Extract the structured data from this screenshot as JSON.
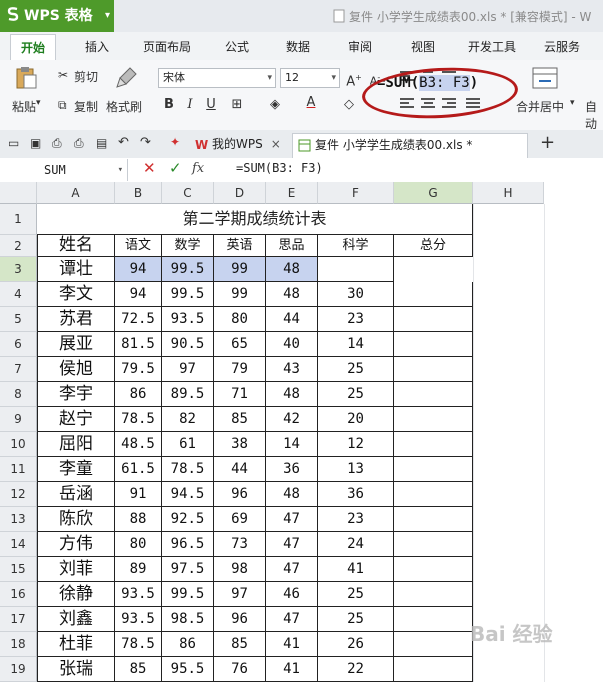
{
  "app": {
    "name": "WPS 表格",
    "doc_title": "复件 小学学生成绩表00.xls * [兼容模式] - W"
  },
  "menu": {
    "tabs": [
      "开始",
      "插入",
      "页面布局",
      "公式",
      "数据",
      "审阅",
      "视图",
      "开发工具",
      "云服务"
    ]
  },
  "toolbar": {
    "cut": "剪切",
    "copy": "复制",
    "paste": "粘贴",
    "format_painter": "格式刷",
    "font_name": "宋体",
    "font_size": "12",
    "merge_center": "合并居中",
    "auto_wrap": "自动"
  },
  "doc_tabs": {
    "tab1": "我的WPS",
    "tab2": "复件  小学学生成绩表00.xls *"
  },
  "formula_bar": {
    "name_box": "SUM",
    "fx": "fx",
    "formula": "=SUM(B3: F3)"
  },
  "sheet": {
    "columns": [
      "A",
      "B",
      "C",
      "D",
      "E",
      "F",
      "G",
      "H"
    ],
    "row_numbers": [
      "1",
      "2",
      "3",
      "4",
      "5",
      "6",
      "7",
      "8",
      "9",
      "10",
      "11",
      "12",
      "13",
      "14",
      "15",
      "16",
      "17",
      "18",
      "19"
    ],
    "title": "第二学期成绩统计表",
    "headers": [
      "姓名",
      "语文",
      "数学",
      "英语",
      "思品",
      "科学",
      "总分"
    ],
    "rows": [
      {
        "name": "谭壮",
        "v": [
          "94",
          "99.5",
          "99",
          "48",
          ""
        ]
      },
      {
        "name": "李文",
        "v": [
          "94",
          "99.5",
          "99",
          "48",
          "30"
        ]
      },
      {
        "name": "苏君",
        "v": [
          "72.5",
          "93.5",
          "80",
          "44",
          "23"
        ]
      },
      {
        "name": "展亚",
        "v": [
          "81.5",
          "90.5",
          "65",
          "40",
          "14"
        ]
      },
      {
        "name": "侯旭",
        "v": [
          "79.5",
          "97",
          "79",
          "43",
          "25"
        ]
      },
      {
        "name": "李宇",
        "v": [
          "86",
          "89.5",
          "71",
          "48",
          "25"
        ]
      },
      {
        "name": "赵宁",
        "v": [
          "78.5",
          "82",
          "85",
          "42",
          "20"
        ]
      },
      {
        "name": "屈阳",
        "v": [
          "48.5",
          "61",
          "38",
          "14",
          "12"
        ]
      },
      {
        "name": "李童",
        "v": [
          "61.5",
          "78.5",
          "44",
          "36",
          "13"
        ]
      },
      {
        "name": "岳涵",
        "v": [
          "91",
          "94.5",
          "96",
          "48",
          "36"
        ]
      },
      {
        "name": "陈欣",
        "v": [
          "88",
          "92.5",
          "69",
          "47",
          "23"
        ]
      },
      {
        "name": "方伟",
        "v": [
          "80",
          "96.5",
          "73",
          "47",
          "24"
        ]
      },
      {
        "name": "刘菲",
        "v": [
          "89",
          "97.5",
          "98",
          "47",
          "41"
        ]
      },
      {
        "name": "徐静",
        "v": [
          "93.5",
          "99.5",
          "97",
          "46",
          "25"
        ]
      },
      {
        "name": "刘鑫",
        "v": [
          "93.5",
          "98.5",
          "96",
          "47",
          "25"
        ]
      },
      {
        "name": "杜菲",
        "v": [
          "78.5",
          "86",
          "85",
          "41",
          "26"
        ]
      },
      {
        "name": "张瑞",
        "v": [
          "85",
          "95.5",
          "76",
          "41",
          "22"
        ]
      }
    ],
    "editing_formula": {
      "prefix": "=SUM(",
      "ref": "B3: F3",
      "suffix": ")"
    }
  },
  "watermark": "Bai 经验",
  "colors": {
    "wps_green": "#4e9a2a",
    "selection": "#c7d3ef",
    "annotation": "#b51a1a"
  }
}
